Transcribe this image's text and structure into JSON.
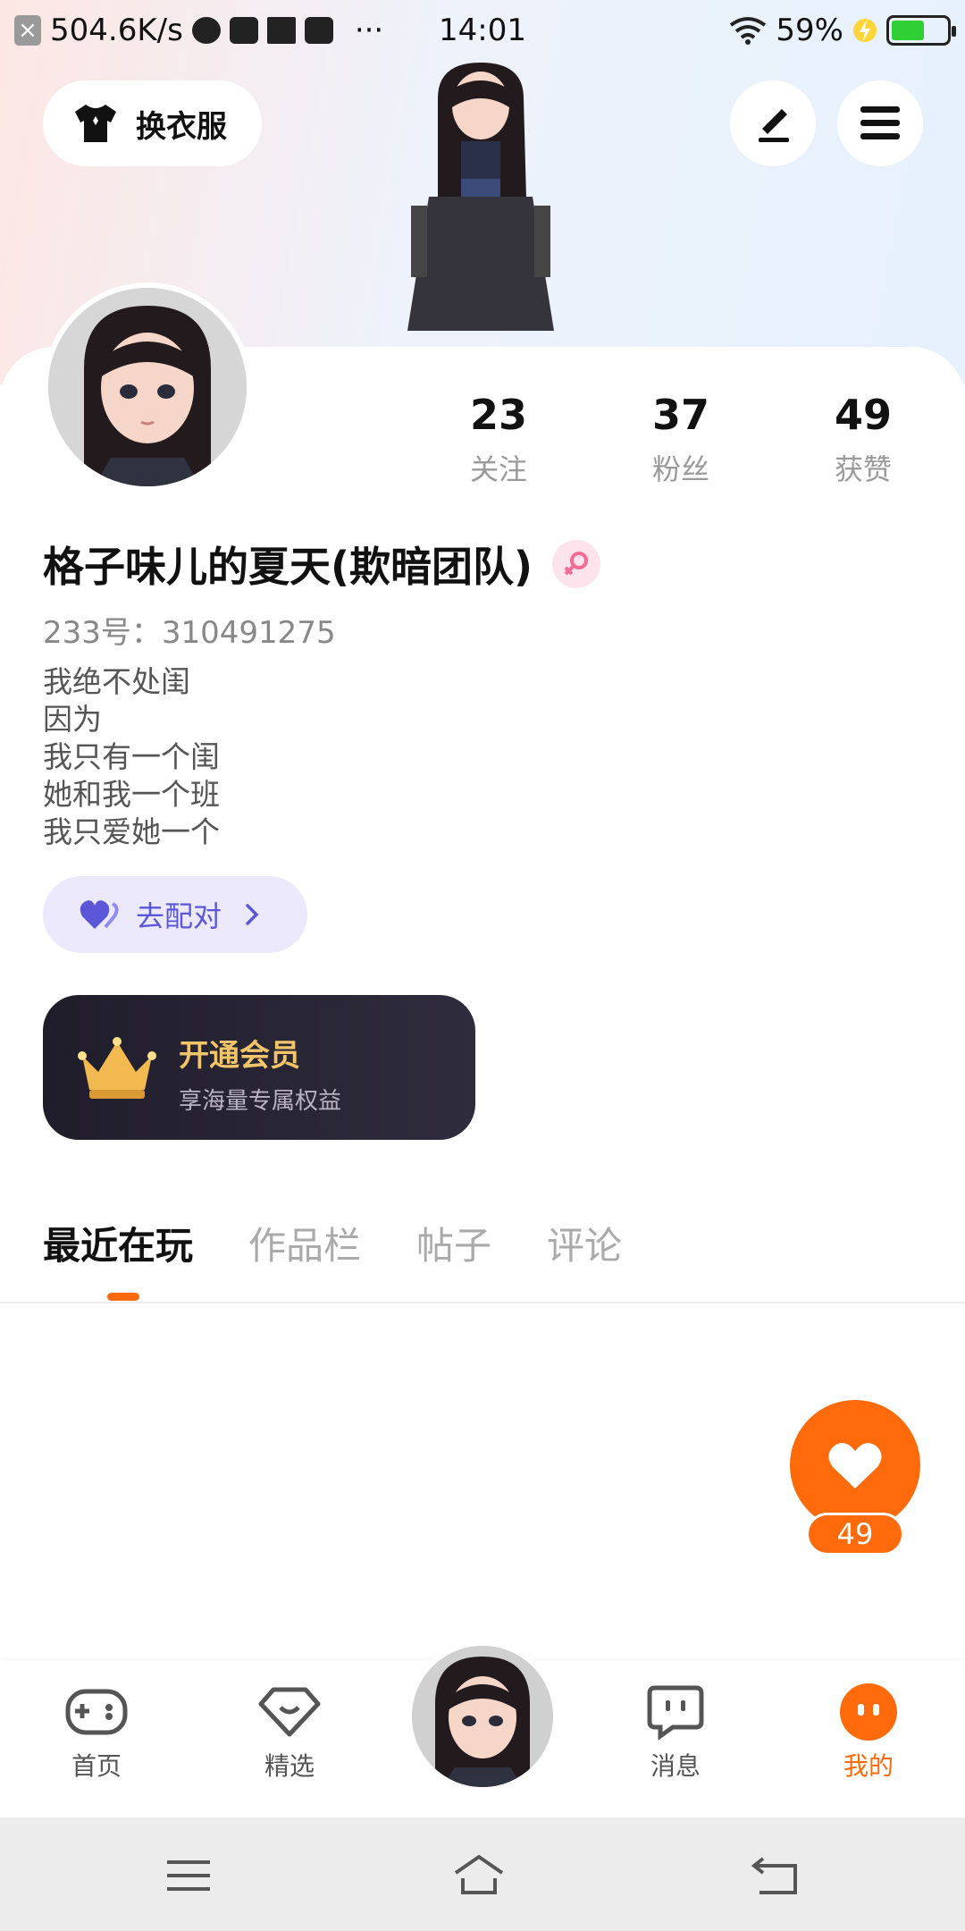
{
  "status_bar": {
    "speed": "504.6K/s",
    "dots": "···",
    "time": "14:01",
    "battery": "59%"
  },
  "top": {
    "change_clothes_label": "换衣服"
  },
  "profile": {
    "stats": [
      {
        "num": "23",
        "label": "关注"
      },
      {
        "num": "37",
        "label": "粉丝"
      },
      {
        "num": "49",
        "label": "获赞"
      }
    ],
    "name": "格子味儿的夏天(欺暗团队)",
    "uid": "233号：310491275",
    "bio": [
      "我绝不处闺",
      "因为",
      "我只有一个闺",
      "她和我一个班",
      "我只爱她一个"
    ],
    "match_label": "去配对",
    "vip": {
      "title": "开通会员",
      "subtitle": "享海量专属权益"
    }
  },
  "tabs": [
    "最近在玩",
    "作品栏",
    "帖子",
    "评论"
  ],
  "like_count": "49",
  "bottom_nav": [
    "首页",
    "精选",
    "消息",
    "我的"
  ],
  "colors": {
    "accent": "#ff6a0a",
    "match": "#5b57d8",
    "vip_gold": "#f2c56a"
  }
}
